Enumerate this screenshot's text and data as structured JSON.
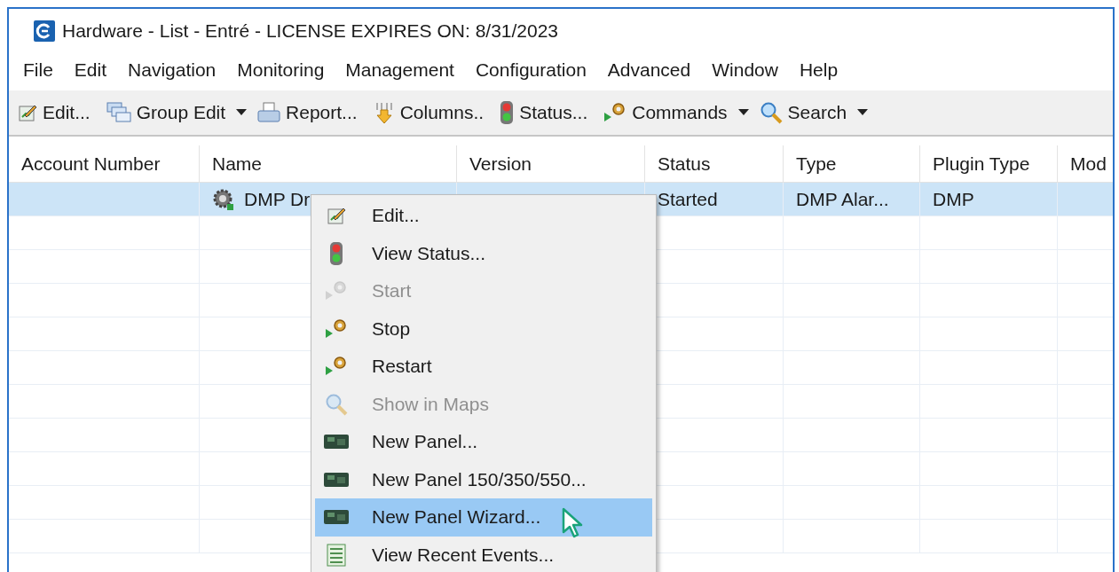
{
  "window": {
    "title": "Hardware - List - Entré - LICENSE EXPIRES ON: 8/31/2023"
  },
  "menu_bar": [
    "File",
    "Edit",
    "Navigation",
    "Monitoring",
    "Management",
    "Configuration",
    "Advanced",
    "Window",
    "Help"
  ],
  "toolbar": [
    {
      "label": "Edit...",
      "kind": "edit",
      "dropdown": false
    },
    {
      "label": "Group Edit",
      "kind": "group",
      "dropdown": true
    },
    {
      "label": "Report...",
      "kind": "report",
      "dropdown": false
    },
    {
      "label": "Columns..",
      "kind": "columns",
      "dropdown": false
    },
    {
      "label": "Status...",
      "kind": "status",
      "dropdown": false
    },
    {
      "label": "Commands",
      "kind": "commands",
      "dropdown": true
    },
    {
      "label": "Search",
      "kind": "search",
      "dropdown": true
    }
  ],
  "table": {
    "columns": [
      "Account Number",
      "Name",
      "Version",
      "Status",
      "Type",
      "Plugin Type",
      "Mod"
    ],
    "rows": [
      {
        "selected": true,
        "cells": [
          "",
          "DMP Dr",
          "",
          "Started",
          "DMP Alar...",
          "DMP",
          ""
        ]
      }
    ]
  },
  "context_menu": {
    "items": [
      {
        "label": "Edit...",
        "kind": "edit",
        "disabled": false,
        "selected": false
      },
      {
        "label": "View Status...",
        "kind": "status",
        "disabled": false,
        "selected": false
      },
      {
        "label": "Start",
        "kind": "commands",
        "disabled": true,
        "selected": false
      },
      {
        "label": "Stop",
        "kind": "commands",
        "disabled": false,
        "selected": false
      },
      {
        "label": "Restart",
        "kind": "commands",
        "disabled": false,
        "selected": false
      },
      {
        "label": "Show in Maps",
        "kind": "search",
        "disabled": true,
        "selected": false
      },
      {
        "label": "New Panel...",
        "kind": "panel",
        "disabled": false,
        "selected": false
      },
      {
        "label": "New Panel 150/350/550...",
        "kind": "panel",
        "disabled": false,
        "selected": false
      },
      {
        "label": "New Panel Wizard...",
        "kind": "panel",
        "disabled": false,
        "selected": true
      },
      {
        "label": "View Recent Events...",
        "kind": "events",
        "disabled": false,
        "selected": false
      }
    ]
  }
}
